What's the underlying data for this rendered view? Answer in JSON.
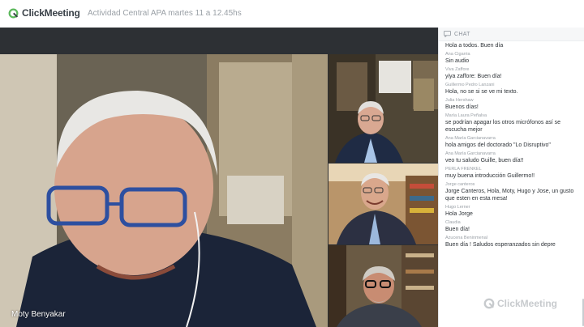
{
  "app": {
    "logo_text": "ClickMeeting",
    "meeting_title": "Actividad Central APA martes 11 a 12.45hs"
  },
  "colors": {
    "brand_green": "#5cb85c",
    "stage_bg": "#2d3034",
    "chat_bg": "#ffffff"
  },
  "icons": {
    "logo": "clickmeeting-logo-icon",
    "chat": "chat-bubble-icon"
  },
  "video": {
    "main_speaker_name": "Moty Benyakar"
  },
  "chat": {
    "header": "CHAT",
    "messages": [
      {
        "author": "",
        "text": "Hola a todos. Buen día"
      },
      {
        "author": "Ana Cigarria",
        "text": "Sin audio"
      },
      {
        "author": "Viva Zaffore",
        "text": "yiya zaffore: Buen día!"
      },
      {
        "author": "Guillermo Pedro Lanzani",
        "text": "Hola, no se si se ve mi texto."
      },
      {
        "author": "Julia Hershaw",
        "text": "Buenos días!"
      },
      {
        "author": "María Laura Peñalva",
        "text": "se podrían apagar los otros micrófonos así se escucha mejor"
      },
      {
        "author": "Ana María Garcianavarra",
        "text": "hola amigos del doctorado \"Lo Disruptivo\""
      },
      {
        "author": "Ana María Garcianavarra",
        "text": "veo tu saludo Guille, buen día!!"
      },
      {
        "author": "PERLA FRENKEL",
        "text": "muy buena introducción Guillermo!!"
      },
      {
        "author": "Jorge canteros",
        "text": "Jorge Canteros, Hola, Moty, Hugo y Jose, un gusto que esten en esta mesa!"
      },
      {
        "author": "Hugo Lerner",
        "text": "Hola Jorge"
      },
      {
        "author": "Claudia",
        "text": "Buen día!"
      },
      {
        "author": "Azucena Beninmenal",
        "text": "Buen día ! Saludos esperanzados sin depre"
      }
    ]
  },
  "watermark": {
    "text": "ClickMeeting"
  }
}
